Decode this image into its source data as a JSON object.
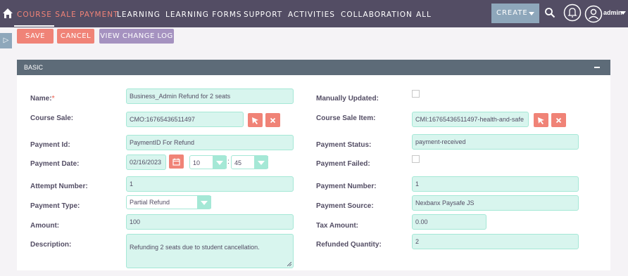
{
  "nav": {
    "module": "COURSE SALE PAYMENT",
    "items": [
      "LEARNING",
      "LEARNING FORMS",
      "SUPPORT",
      "ACTIVITIES",
      "COLLABORATION",
      "ALL"
    ],
    "create_label": "CREATE",
    "user": "admin"
  },
  "actions": {
    "save": "SAVE",
    "cancel": "CANCEL",
    "view_log": "VIEW CHANGE LOG"
  },
  "panel": {
    "title": "BASIC"
  },
  "form": {
    "name_label": "Name:",
    "name_required_mark": "*",
    "name_value": "Business_Admin Refund for 2 seats",
    "course_sale_label": "Course Sale:",
    "course_sale_value": "CMO:16765436511497",
    "payment_id_label": "Payment Id:",
    "payment_id_value": "PaymentID For Refund",
    "payment_date_label": "Payment Date:",
    "payment_date_value": "02/16/2023",
    "payment_hour": "10",
    "payment_minute": "45",
    "time_separator": ":",
    "attempt_number_label": "Attempt Number:",
    "attempt_number_value": "1",
    "payment_type_label": "Payment Type:",
    "payment_type_value": "Partial Refund",
    "amount_label": "Amount:",
    "amount_value": "100",
    "description_label": "Description:",
    "description_value": "Refunding 2 seats due to student cancellation.",
    "manually_updated_label": "Manually Updated:",
    "manually_updated_checked": false,
    "course_sale_item_label": "Course Sale Item:",
    "course_sale_item_value": "CMI:16765436511497-health-and-safe",
    "payment_status_label": "Payment Status:",
    "payment_status_value": "payment-received",
    "payment_failed_label": "Payment Failed:",
    "payment_failed_checked": false,
    "payment_number_label": "Payment Number:",
    "payment_number_value": "1",
    "payment_source_label": "Payment Source:",
    "payment_source_value": "Nexbanx Paysafe JS",
    "tax_amount_label": "Tax Amount:",
    "tax_amount_value": "0.00",
    "refunded_quantity_label": "Refunded Quantity:",
    "refunded_quantity_value": "2"
  },
  "colors": {
    "nav_bg": "#534d64",
    "accent": "#f08377",
    "field_bg": "#d8f5ee",
    "field_border": "#a5e8d6",
    "panel_head": "#5d6b78",
    "log_button": "#a592c0"
  }
}
